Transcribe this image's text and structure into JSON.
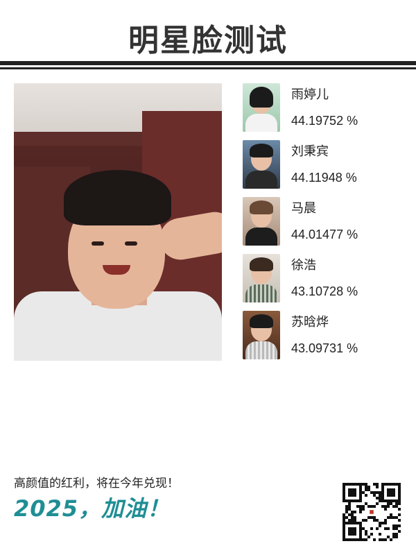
{
  "header": {
    "title": "明星脸测试"
  },
  "results": [
    {
      "name": "雨婷儿",
      "score": "44.19752 %",
      "icon": "portrait-girl"
    },
    {
      "name": "刘秉宾",
      "score": "44.11948 %",
      "icon": "portrait-boy"
    },
    {
      "name": "马晨",
      "score": "44.01477 %",
      "icon": "portrait-boy"
    },
    {
      "name": "徐浩",
      "score": "43.10728 %",
      "icon": "portrait-boy"
    },
    {
      "name": "苏晗烨",
      "score": "43.09731 %",
      "icon": "portrait-boy"
    }
  ],
  "footer": {
    "slogan": "高颜值的红利，将在今年兑现！",
    "cheer": "2025，加油！",
    "qr_icon": "qr-code-icon"
  },
  "colors": {
    "title": "#333333",
    "cheer": "#1f8e94",
    "rule": "#222222"
  }
}
